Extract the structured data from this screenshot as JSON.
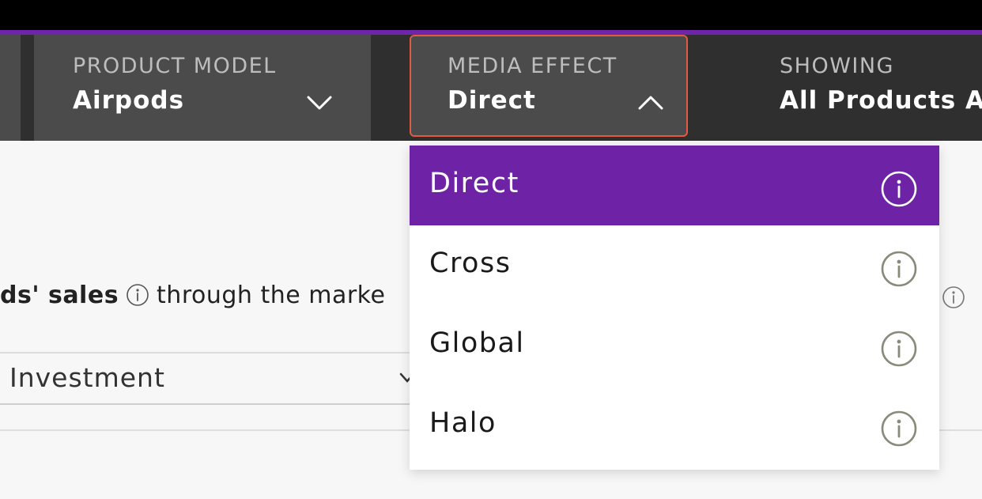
{
  "filters": {
    "product_model": {
      "label": "PRODUCT MODEL",
      "value": "Airpods",
      "chevron": "chevron-down-icon"
    },
    "media_effect": {
      "label": "MEDIA EFFECT",
      "value": "Direct",
      "chevron": "chevron-up-icon"
    },
    "showing": {
      "label": "SHOWING",
      "value": "All Products A"
    }
  },
  "dropdown": {
    "options": [
      {
        "label": "Direct",
        "selected": true,
        "icon": "info-icon"
      },
      {
        "label": "Cross",
        "selected": false,
        "icon": "info-icon"
      },
      {
        "label": "Global",
        "selected": false,
        "icon": "info-icon"
      },
      {
        "label": "Halo",
        "selected": false,
        "icon": "info-icon"
      }
    ]
  },
  "content": {
    "sentence_bold": "ds' sales",
    "sentence_rest": "through the marke",
    "metric_select_value": "Investment"
  },
  "colors": {
    "accent": "#6e22a6",
    "highlight_border": "#e05a44",
    "filterbar_bg": "#2f2f2f",
    "filter_segment_bg": "#4b4b4b"
  }
}
